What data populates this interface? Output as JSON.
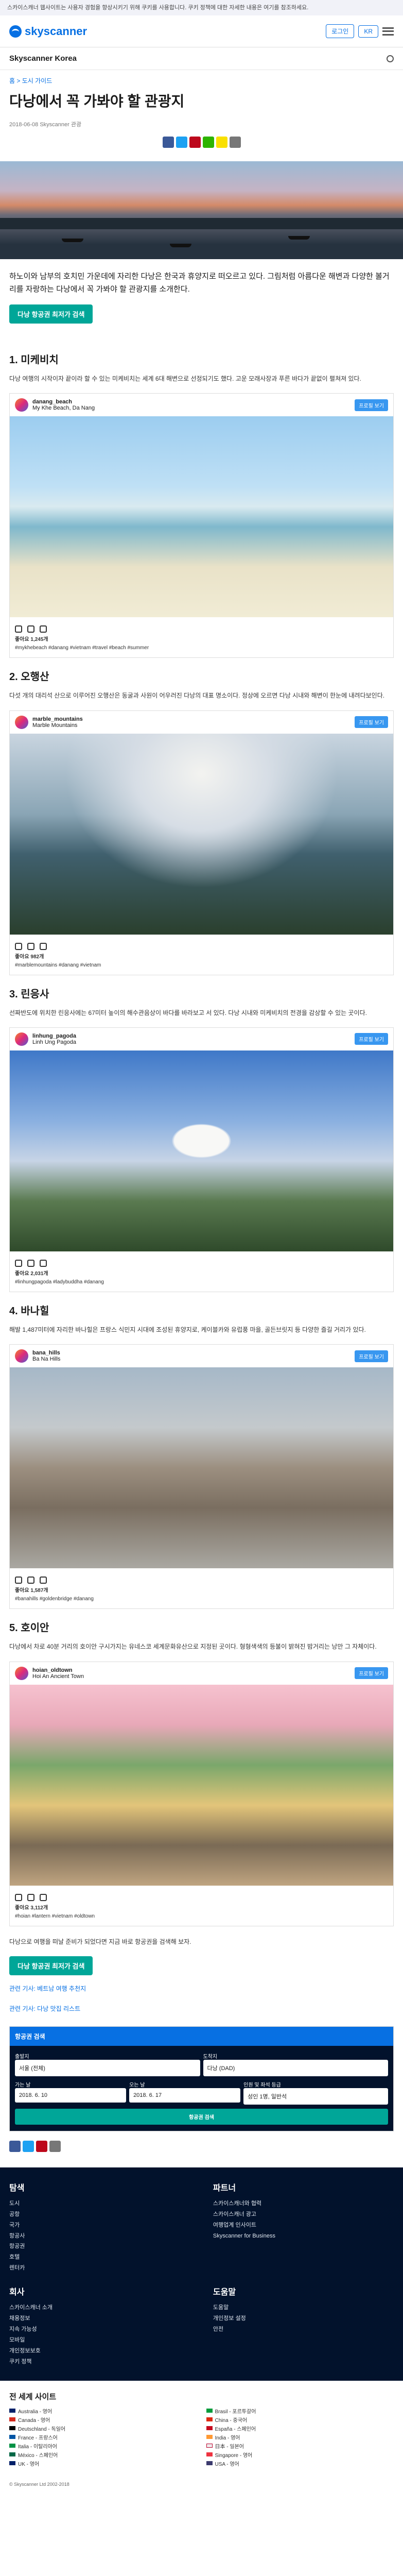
{
  "topbar": {
    "text": "스카이스캐너 웹사이트는 사용자 경험을 향상시키기 위해 쿠키를 사용합니다. 쿠키 정책에 대한 자세한 내용은 여기를 참조하세요."
  },
  "header": {
    "logo": "skyscanner",
    "login": "로그인",
    "lang": "KR"
  },
  "subnav": {
    "title": "Skyscanner Korea"
  },
  "crumb": "홈 > 도시 가이드",
  "article": {
    "title": "다낭에서 꼭 가봐야 할 관광지",
    "meta": "2018-06-08 Skyscanner 관광",
    "lead": "하노이와 남부의 호치민 가운데에 자리한 다낭은 한국과 휴양지로 떠오르고 있다. 그림처럼 아름다운 해변과 다양한 볼거리를 자랑하는 다낭에서 꼭 가봐야 할 관광지를 소개한다.",
    "cta": "다낭 항공권 최저가 검색"
  },
  "sections": [
    {
      "title": "1. 미케비치",
      "text": "다낭 여행의 시작이자 끝이라 할 수 있는 미케비치는 세계 6대 해변으로 선정되기도 했다. 고운 모래사장과 푸른 바다가 끝없이 펼쳐져 있다.",
      "user": "danang_beach",
      "sub": "My Khe Beach, Da Nang",
      "likes": "좋아요 1,245개",
      "caption": "#mykhebeach #danang #vietnam #travel #beach #summer"
    },
    {
      "title": "2. 오행산",
      "text": "다섯 개의 대리석 산으로 이루어진 오행산은 동굴과 사원이 어우러진 다낭의 대표 명소이다. 정상에 오르면 다낭 시내와 해변이 한눈에 내려다보인다.",
      "user": "marble_mountains",
      "sub": "Marble Mountains",
      "likes": "좋아요 982개",
      "caption": "#marblemountains #danang #vietnam"
    },
    {
      "title": "3. 린응사",
      "text": "선짜반도에 위치한 린응사에는 67미터 높이의 해수관음상이 바다를 바라보고 서 있다. 다낭 시내와 미케비치의 전경을 감상할 수 있는 곳이다.",
      "user": "linhung_pagoda",
      "sub": "Linh Ung Pagoda",
      "likes": "좋아요 2,031개",
      "caption": "#linhungpagoda #ladybuddha #danang"
    },
    {
      "title": "4. 바나힐",
      "text": "해발 1,487미터에 자리한 바나힐은 프랑스 식민지 시대에 조성된 휴양지로, 케이블카와 유럽풍 마을, 골든브릿지 등 다양한 즐길 거리가 있다.",
      "user": "bana_hills",
      "sub": "Ba Na Hills",
      "likes": "좋아요 1,587개",
      "caption": "#banahills #goldenbridge #danang"
    },
    {
      "title": "5. 호이안",
      "text": "다낭에서 차로 40분 거리의 호이안 구시가지는 유네스코 세계문화유산으로 지정된 곳이다. 형형색색의 등불이 밝혀진 밤거리는 낭만 그 자체이다.",
      "user": "hoian_oldtown",
      "sub": "Hoi An Ancient Town",
      "likes": "좋아요 3,112개",
      "caption": "#hoian #lantern #vietnam #oldtown"
    }
  ],
  "closing": {
    "text": "다낭으로 여행을 떠날 준비가 되었다면 지금 바로 항공권을 검색해 보자.",
    "cta": "다낭 항공권 최저가 검색",
    "link1": "관련 기사: 베트남 여행 추천지",
    "link2": "관련 기사: 다낭 맛집 리스트"
  },
  "search": {
    "head": "항공권 검색",
    "from_label": "출발지",
    "from": "서울 (전체)",
    "to_label": "도착지",
    "to": "다낭 (DAD)",
    "depart_label": "가는 날",
    "depart": "2018. 6. 10",
    "return_label": "오는 날",
    "return": "2018. 6. 17",
    "pax_label": "인원 및 좌석 등급",
    "pax": "성인 1명, 일반석",
    "button": "항공권 검색"
  },
  "footer": {
    "col1": {
      "title": "탐색",
      "items": [
        "도시",
        "공항",
        "국가",
        "항공사",
        "항공권",
        "호텔",
        "렌터카"
      ]
    },
    "col2": {
      "title": "파트너",
      "items": [
        "스카이스캐너와 협력",
        "스카이스캐너 광고",
        "여행업계 인사이트",
        "Skyscanner for Business"
      ]
    },
    "col3": {
      "title": "회사",
      "items": [
        "스카이스캐너 소개",
        "채용정보",
        "지속 가능성",
        "모바일",
        "개인정보보호",
        "쿠키 정책"
      ]
    },
    "col4": {
      "title": "도움말",
      "items": [
        "도움말",
        "개인정보 설정",
        "안전"
      ]
    }
  },
  "sites": {
    "title": "전 세계 사이트",
    "items": [
      "Australia - 영어",
      "Brasil - 포르투갈어",
      "Canada - 영어",
      "China - 중국어",
      "Deutschland - 독일어",
      "España - 스페인어",
      "France - 프랑스어",
      "India - 영어",
      "Italia - 이탈리아어",
      "日本 - 일본어",
      "México - 스페인어",
      "Singapore - 영어",
      "UK - 영어",
      "USA - 영어"
    ]
  },
  "copyright": "© Skyscanner Ltd 2002-2018"
}
